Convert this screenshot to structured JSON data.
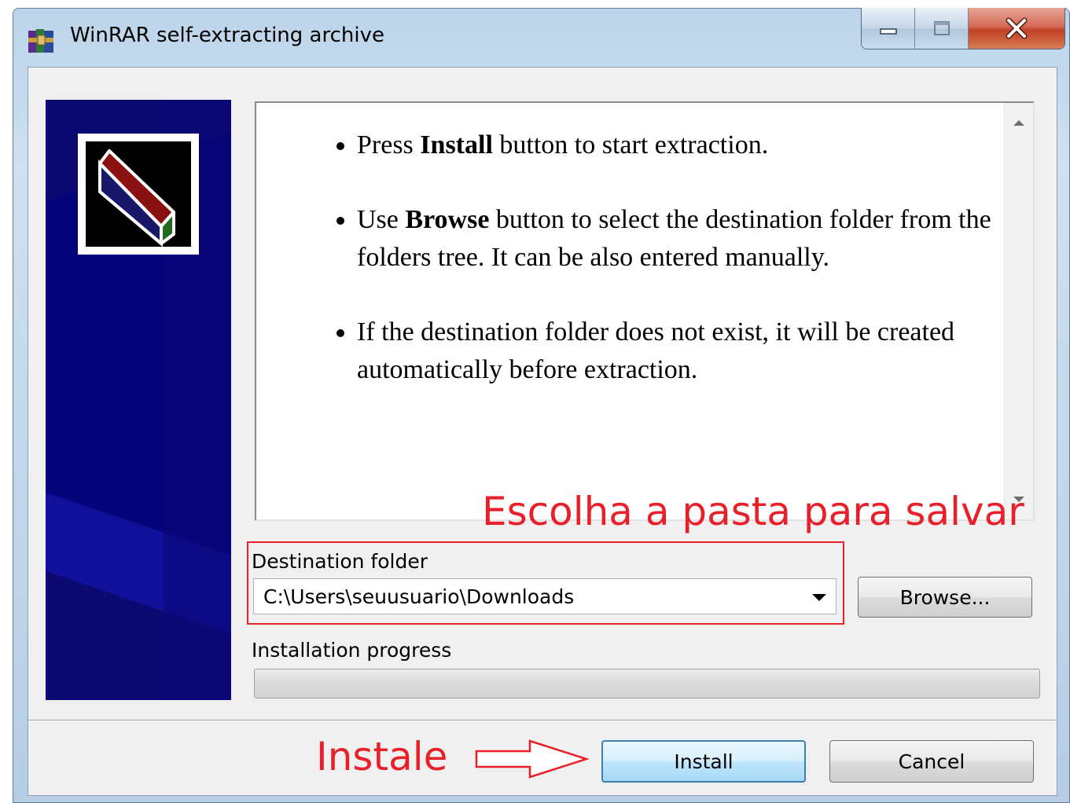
{
  "window": {
    "title": "WinRAR self-extracting archive",
    "app_icon": "winrar-books-icon",
    "controls": {
      "minimize": "minimize-icon",
      "maximize": "maximize-icon",
      "close": "close-icon"
    }
  },
  "banner": {
    "logo_icon": "archive-box-icon",
    "background_color": "#0d0972"
  },
  "instructions": [
    {
      "before": "Press ",
      "bold": "Install",
      "after": " button to start extraction."
    },
    {
      "before": "Use ",
      "bold": "Browse",
      "after": " button to select the destination folder from the folders tree. It can be also entered manually."
    },
    {
      "before": "",
      "bold": "",
      "after": "If the destination folder does not exist, it will be created automatically before extraction."
    }
  ],
  "destination": {
    "label": "Destination folder",
    "value": "C:\\Users\\seuusuario\\Downloads",
    "browse_label": "Browse..."
  },
  "progress": {
    "label": "Installation progress",
    "value": 0
  },
  "buttons": {
    "install": "Install",
    "cancel": "Cancel"
  },
  "annotations": {
    "choose_folder": "Escolha a pasta para salvar",
    "install": "Instale",
    "color": "#e8202a"
  }
}
